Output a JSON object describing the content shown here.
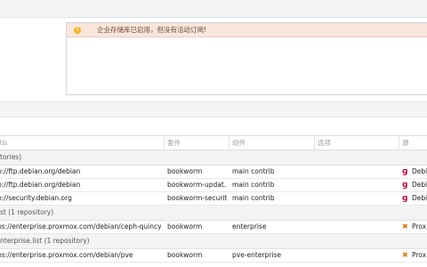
{
  "alert": {
    "text": "企业存储库已启用，但没有活动订阅!",
    "icon": "warning-icon"
  },
  "table": {
    "columns": [
      "RIs",
      "套件",
      "组件",
      "选项",
      "源"
    ],
    "groups": [
      {
        "label": "tories)",
        "rows": [
          {
            "uri": "p://ftp.debian.org/debian",
            "suite": "bookworm",
            "components": "main contrib",
            "options": "",
            "origin": "Debi",
            "origin_icon": "debian-icon"
          },
          {
            "uri": "p://ftp.debian.org/debian",
            "suite": "bookworm-updat...",
            "components": "main contrib",
            "options": "",
            "origin": "Debi",
            "origin_icon": "debian-icon"
          },
          {
            "uri": "p://security.debian.org",
            "suite": "bookworm-security",
            "components": "main contrib",
            "options": "",
            "origin": "Debi",
            "origin_icon": "debian-icon"
          }
        ]
      },
      {
        "label": "st (1 repository)",
        "rows": [
          {
            "uri": "ps://enterprise.proxmox.com/debian/ceph-quincy",
            "suite": "bookworm",
            "components": "enterprise",
            "options": "",
            "origin": "Prox",
            "origin_icon": "proxmox-icon"
          }
        ]
      },
      {
        "label": "nterprise.list (1 repository)",
        "rows": [
          {
            "uri": "ps://enterprise.proxmox.com/debian/pve",
            "suite": "bookworm",
            "components": "pve-enterprise",
            "options": "",
            "origin": "Prox",
            "origin_icon": "proxmox-icon"
          }
        ]
      }
    ]
  }
}
